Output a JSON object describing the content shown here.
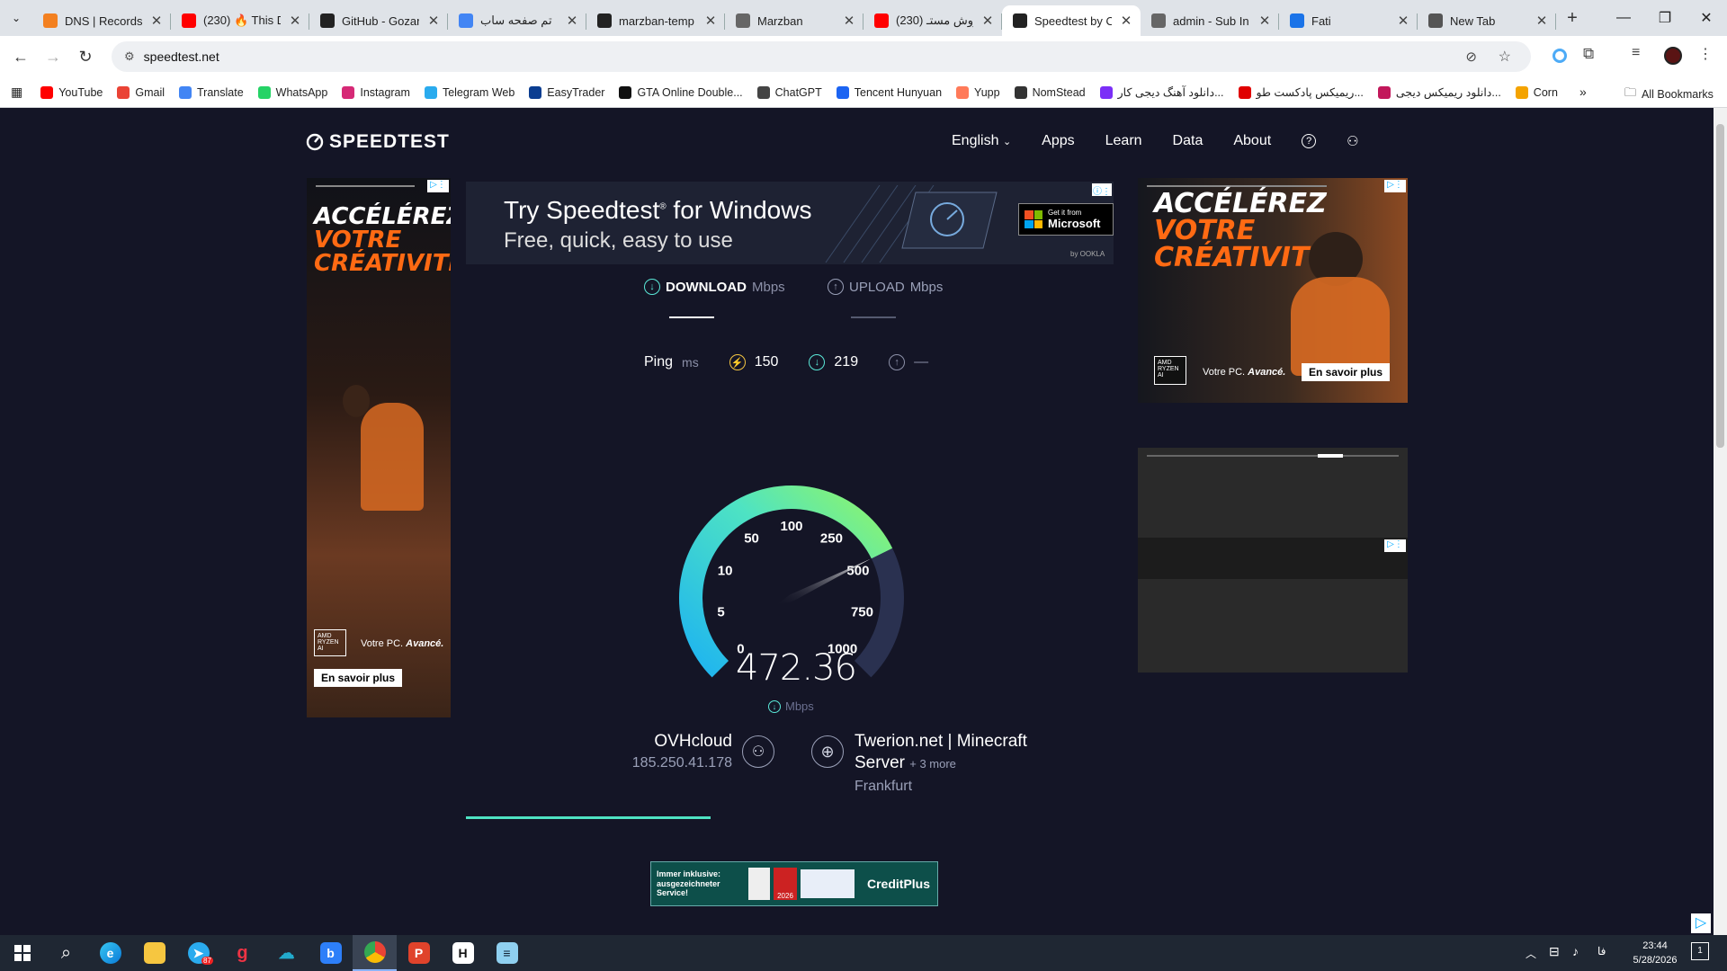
{
  "browser": {
    "tabs": [
      {
        "label": "DNS | Records",
        "color": "#f38020",
        "active": false
      },
      {
        "label": "(230) 🔥 This D",
        "color": "#ff0000",
        "active": false
      },
      {
        "label": "GitHub - Gozar",
        "color": "#222222",
        "active": false
      },
      {
        "label": "تم صفحه ساب",
        "color": "#4285f4",
        "active": false
      },
      {
        "label": "marzban-temp",
        "color": "#222222",
        "active": false
      },
      {
        "label": "Marzban",
        "color": "#666666",
        "active": false
      },
      {
        "label": "(230) روش مستـ",
        "color": "#ff0000",
        "active": false
      },
      {
        "label": "Speedtest by O",
        "color": "#222222",
        "active": true
      },
      {
        "label": "admin - Sub In",
        "color": "#666666",
        "active": false
      },
      {
        "label": "Fati",
        "color": "#1a73e8",
        "active": false
      },
      {
        "label": "New Tab",
        "color": "#555555",
        "active": false
      }
    ],
    "url": "speedtest.net",
    "bookmarks": [
      {
        "label": "YouTube",
        "color": "#ff0000"
      },
      {
        "label": "Gmail",
        "color": "#ea4335"
      },
      {
        "label": "Translate",
        "color": "#4285f4"
      },
      {
        "label": "WhatsApp",
        "color": "#25d366"
      },
      {
        "label": "Instagram",
        "color": "#d62976"
      },
      {
        "label": "Telegram Web",
        "color": "#2aabee"
      },
      {
        "label": "EasyTrader",
        "color": "#0b3d91"
      },
      {
        "label": "GTA Online Double...",
        "color": "#111111"
      },
      {
        "label": "ChatGPT",
        "color": "#444444"
      },
      {
        "label": "Tencent Hunyuan",
        "color": "#1c64f2"
      },
      {
        "label": "Yupp",
        "color": "#ff7a59"
      },
      {
        "label": "NomStead",
        "color": "#333333"
      },
      {
        "label": "دانلود آهنگ دیجی کار...",
        "color": "#7b2ff7"
      },
      {
        "label": "ریمیکس پادکست طو...",
        "color": "#e00000"
      },
      {
        "label": "دانلود ریمیکس دیجی...",
        "color": "#c2185b"
      },
      {
        "label": "Corn",
        "color": "#f4a300"
      }
    ],
    "more_bookmarks": "»",
    "all_bookmarks": "All Bookmarks"
  },
  "speedtest": {
    "logo": "SPEEDTEST",
    "nav": [
      "English",
      "Apps",
      "Learn",
      "Data",
      "About"
    ],
    "banner": {
      "title": "Try Speedtest",
      "title_suffix": " for Windows",
      "subtitle": "Free, quick, easy to use",
      "store_small": "Get it from",
      "store_big": "Microsoft",
      "by": "by OOKLA"
    },
    "download_label": "DOWNLOAD",
    "upload_label": "UPLOAD",
    "unit": "Mbps",
    "ping_label": "Ping",
    "ping_unit": "ms",
    "ping_idle": "150",
    "ping_download": "219",
    "ping_upload": "—",
    "gauge_labels": [
      "0",
      "5",
      "10",
      "50",
      "100",
      "250",
      "500",
      "750",
      "1000"
    ],
    "speed_value": "472.36",
    "speed_unit": "Mbps",
    "isp_name": "OVHcloud",
    "isp_ip": "185.250.41.178",
    "server_name_1": "Twerion.net | Minecraft",
    "server_name_2": "Server",
    "server_more": "+ 3 more",
    "server_location": "Frankfurt",
    "progress_fraction": 0.33
  },
  "ads": {
    "left": {
      "line1": "ACCÉLÉREZ",
      "line2": "VOTRE",
      "line3": "CRÉATIVITÉ",
      "brand": "AMD RYZEN AI",
      "tag1": "Votre PC. ",
      "tag2": "Avancé.",
      "cta": "En savoir plus"
    },
    "right": {
      "line1": "ACCÉLÉREZ",
      "line2": "VOTRE",
      "line3": "CRÉATIVITÉ",
      "brand": "AMD RYZEN AI",
      "tag1": "Votre PC. ",
      "tag2": "Avancé.",
      "cta": "En savoir plus"
    },
    "bottom": {
      "text": "Immer inklusive: ausgezeichneter Service!",
      "brand": "CreditPlus",
      "badge": "2026"
    }
  },
  "taskbar": {
    "time": "23:44",
    "date": "5/28/2026",
    "lang": "فا",
    "telegram_badge": "87",
    "notif_count": "1"
  }
}
